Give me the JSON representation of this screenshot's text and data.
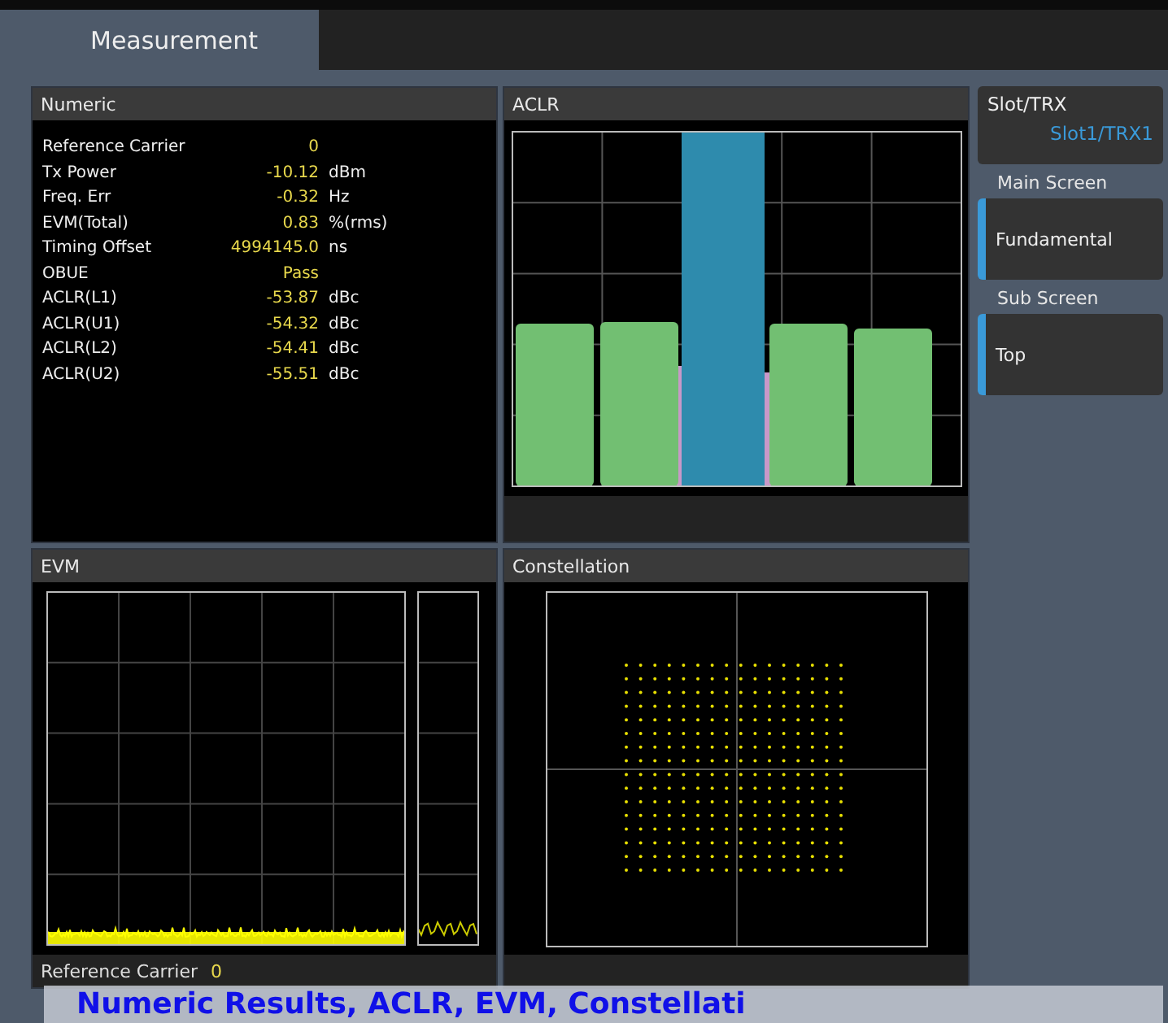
{
  "tab": {
    "label": "Measurement",
    "selected": true
  },
  "numeric": {
    "title": "Numeric",
    "rows": [
      {
        "label": "Reference Carrier",
        "value": "0"
      },
      {
        "label": "Tx Power",
        "value": "-10.12",
        "unit": "dBm"
      },
      {
        "label": "Freq. Err",
        "value": "-0.32",
        "unit": "Hz"
      },
      {
        "label": "EVM(Total)",
        "value": "0.83",
        "unit": "%(rms)"
      },
      {
        "label": "Timing Offset",
        "value": "4994145.0",
        "unit": "ns"
      },
      {
        "label": "OBUE",
        "value": "Pass"
      },
      {
        "label": "ACLR(L1)",
        "value": "-53.87",
        "unit": "dBc"
      },
      {
        "label": "ACLR(U1)",
        "value": "-54.32",
        "unit": "dBc"
      },
      {
        "label": "ACLR(L2)",
        "value": "-54.41",
        "unit": "dBc"
      },
      {
        "label": "ACLR(U2)",
        "value": "-55.51",
        "unit": "dBc"
      }
    ]
  },
  "aclr": {
    "title": "ACLR"
  },
  "evm": {
    "title": "EVM",
    "footer_label": "Reference Carrier",
    "footer_value": "0"
  },
  "constellation": {
    "title": "Constellation"
  },
  "sidebar": {
    "slot": {
      "label": "Slot/TRX",
      "value": "Slot1/TRX1"
    },
    "sections": [
      {
        "heading": "Main Screen",
        "button": "Fundamental",
        "selected": true
      },
      {
        "heading": "Sub Screen",
        "button": "Top",
        "selected": true
      }
    ]
  },
  "caption": "Numeric Results, ACLR, EVM, Constellati"
}
